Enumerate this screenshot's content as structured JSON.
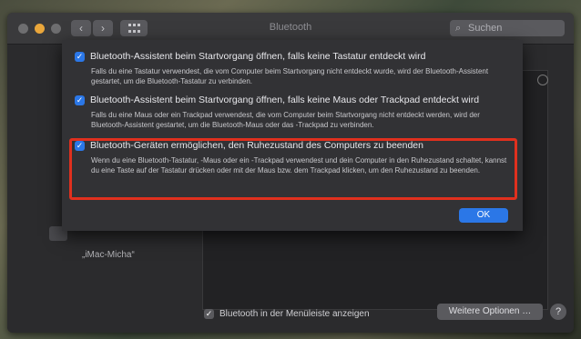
{
  "window": {
    "title": "Bluetooth",
    "search_placeholder": "Suchen",
    "back_glyph": "‹",
    "forward_glyph": "›"
  },
  "main": {
    "device_label": "„iMac-Micha“",
    "show_in_menubar_label": "Bluetooth in der Menüleiste anzeigen",
    "show_in_menubar_checked": true,
    "more_options_label": "Weitere Optionen …",
    "help_label": "?"
  },
  "sheet": {
    "options": [
      {
        "checked": true,
        "title": "Bluetooth-Assistent beim Startvorgang öffnen, falls keine Tastatur entdeckt wird",
        "description": "Falls du eine Tastatur verwendest, die vom Computer beim Startvorgang nicht entdeckt wurde, wird der Bluetooth-Assistent gestartet, um die Bluetooth-Tastatur zu verbinden."
      },
      {
        "checked": true,
        "title": "Bluetooth-Assistent beim Startvorgang öffnen, falls keine Maus oder Trackpad entdeckt wird",
        "description": "Falls du eine Maus oder ein Trackpad verwendest, die vom Computer beim Startvorgang nicht entdeckt werden, wird der Bluetooth-Assistent gestartet, um die Bluetooth-Maus oder das -Trackpad zu verbinden."
      },
      {
        "checked": true,
        "title": "Bluetooth-Geräten ermöglichen, den Ruhezustand des Computers zu beenden",
        "description": "Wenn du eine Bluetooth-Tastatur, -Maus oder ein -Trackpad verwendest und dein Computer in den Ruhezustand schaltet, kannst du eine Taste auf der Tastatur drücken oder mit der Maus bzw. dem Trackpad klicken, um den Ruhezustand zu beenden."
      }
    ],
    "ok_label": "OK"
  },
  "colors": {
    "accent": "#2b77e7",
    "highlight": "#e0301e",
    "minimize": "#e9a63b"
  },
  "icons": [
    "close-icon",
    "minimize-icon",
    "zoom-icon",
    "back-icon",
    "forward-icon",
    "grid-icon",
    "search-icon",
    "checkmark-icon",
    "help-icon"
  ]
}
